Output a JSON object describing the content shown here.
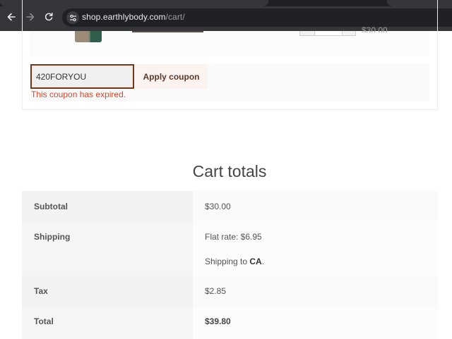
{
  "browser": {
    "url_domain": "shop.earthlybody.com",
    "url_path": "/cart/",
    "icons": {
      "back": "arrow-left-icon",
      "forward": "arrow-right-icon",
      "reload": "reload-icon",
      "site_info": "tune-icon"
    },
    "colors": {
      "chrome": "#35363a",
      "omnibox": "#202124"
    }
  },
  "cart": {
    "line_price": "$30.00"
  },
  "coupon": {
    "value": "420FORYOU",
    "apply_label": "Apply coupon",
    "error": "This coupon has expired.",
    "error_color": "#d9472b"
  },
  "totals": {
    "title": "Cart totals",
    "subtotal_label": "Subtotal",
    "subtotal_value": "$30.00",
    "shipping_label": "Shipping",
    "shipping_rate": "Flat rate: $6.95",
    "shipping_to_prefix": "Shipping to",
    "shipping_region": "CA",
    "shipping_to_suffix": ".",
    "tax_label": "Tax",
    "tax_value": "$2.85",
    "total_label": "Total",
    "total_value": "$39.80"
  }
}
